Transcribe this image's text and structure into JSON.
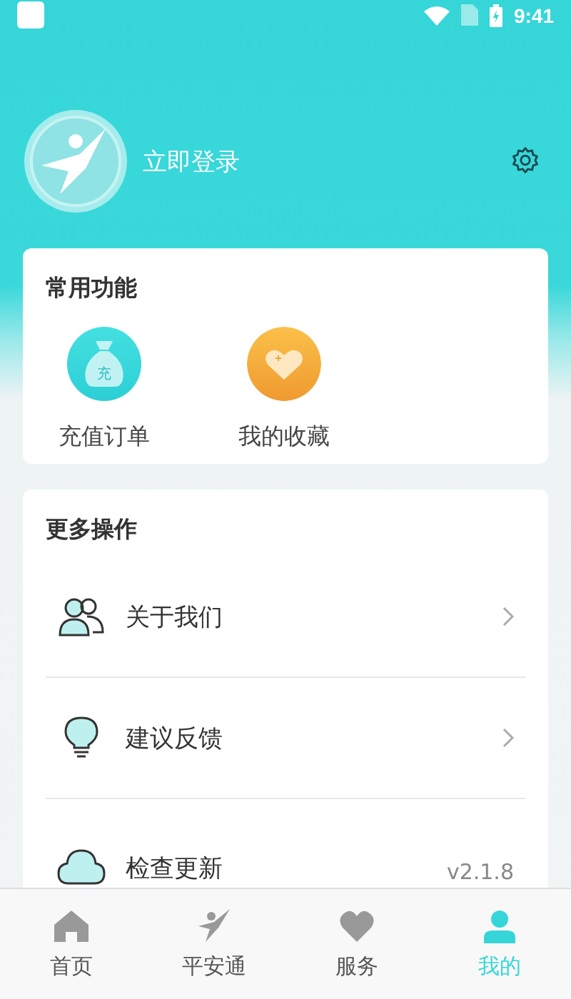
{
  "status_bar": {
    "time": "9:41"
  },
  "profile": {
    "login_label": "立即登录"
  },
  "common_functions": {
    "title": "常用功能",
    "items": [
      {
        "kind": "bag",
        "label": "充值订单",
        "icon_text": "充"
      },
      {
        "kind": "heart",
        "label": "我的收藏"
      }
    ]
  },
  "more_actions": {
    "title": "更多操作",
    "items": [
      {
        "kind": "people",
        "label": "关于我们"
      },
      {
        "kind": "bulb",
        "label": "建议反馈"
      },
      {
        "kind": "cloud",
        "label": "检查更新",
        "value": "v2.1.8"
      }
    ]
  },
  "tabs": [
    {
      "kind": "home",
      "label": "首页",
      "selected": false
    },
    {
      "kind": "runner",
      "label": "平安通",
      "selected": false
    },
    {
      "kind": "heart",
      "label": "服务",
      "selected": false
    },
    {
      "kind": "person",
      "label": "我的",
      "selected": true
    }
  ]
}
